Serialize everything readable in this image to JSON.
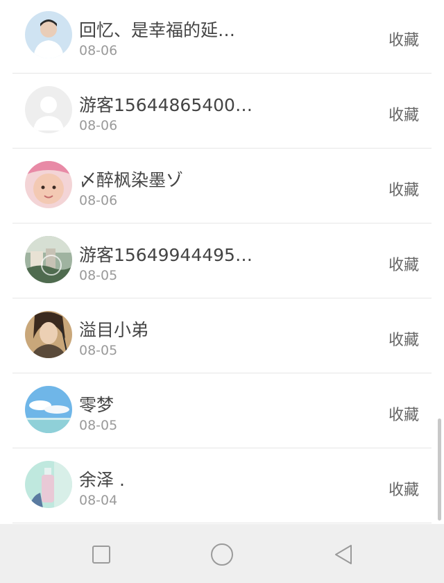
{
  "contacts": [
    {
      "name": "回忆、是幸福的延…",
      "date": "08-06",
      "action": "收藏",
      "avatar": "photo-avatar-boy"
    },
    {
      "name": "游客15644865400…",
      "date": "08-06",
      "action": "收藏",
      "avatar": "default-avatar"
    },
    {
      "name": "〆醉枫染墨ゾ",
      "date": "08-06",
      "action": "收藏",
      "avatar": "photo-avatar-child"
    },
    {
      "name": "游客15649944495…",
      "date": "08-05",
      "action": "收藏",
      "avatar": "photo-avatar-scenery"
    },
    {
      "name": "溢目小弟",
      "date": "08-05",
      "action": "收藏",
      "avatar": "photo-avatar-portrait"
    },
    {
      "name": "零梦",
      "date": "08-05",
      "action": "收藏",
      "avatar": "photo-avatar-sky"
    },
    {
      "name": "余泽 .",
      "date": "08-04",
      "action": "收藏",
      "avatar": "photo-avatar-bottle"
    }
  ],
  "navbar": {
    "buttons": [
      "recent-apps-icon",
      "home-icon",
      "back-icon"
    ]
  },
  "colors": {
    "text_primary": "#444444",
    "text_secondary": "#9a9a9a",
    "divider": "#e6e6e6",
    "navbar_bg": "#efefef"
  }
}
